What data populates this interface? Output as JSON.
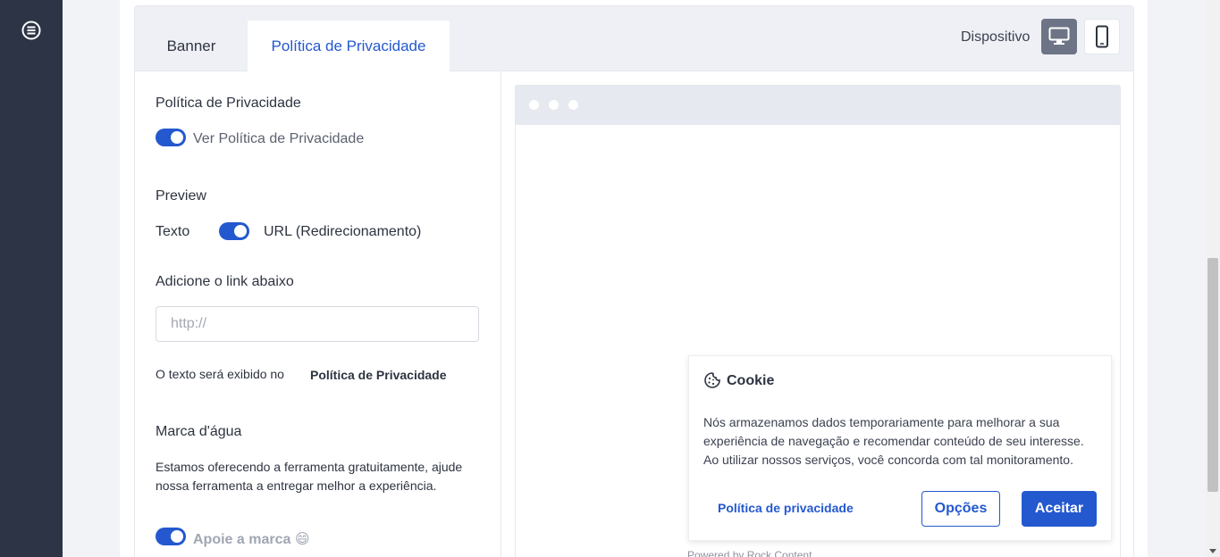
{
  "tabs": [
    {
      "label": "Banner"
    },
    {
      "label": "Política de Privacidade"
    }
  ],
  "device": {
    "label": "Dispositivo"
  },
  "settings": {
    "privacy_heading": "Política de Privacidade",
    "privacy_toggle_label": "Ver Política de Privacidade",
    "preview_heading": "Preview",
    "preview_text_label": "Texto",
    "preview_url_label": "URL (Redirecionamento)",
    "link_heading": "Adicione o link abaixo",
    "link_placeholder": "http://",
    "display_text_prefix": "O texto será exibido no",
    "display_text_value": "Política de Privacidade",
    "watermark_heading": "Marca d'água",
    "watermark_description": "Estamos oferecendo a ferramenta gratuitamente, ajude nossa ferramenta a entregar melhor a experiência.",
    "watermark_toggle_label": "Apoie a marca 😄"
  },
  "cookie_banner": {
    "title": "Cookie",
    "text": "Nós armazenamos dados temporariamente para melhorar a sua experiência de navegação e recomendar conteúdo de seu interesse. Ao utilizar nossos serviços, você concorda com tal monitoramento.",
    "privacy_link": "Política de privacidade",
    "options_button": "Opções",
    "accept_button": "Aceitar",
    "powered_by": "Powered by Rock Content"
  },
  "colors": {
    "accent": "#2458cf",
    "sidebar": "#2d3446",
    "desktop_active": "#6d7486"
  }
}
